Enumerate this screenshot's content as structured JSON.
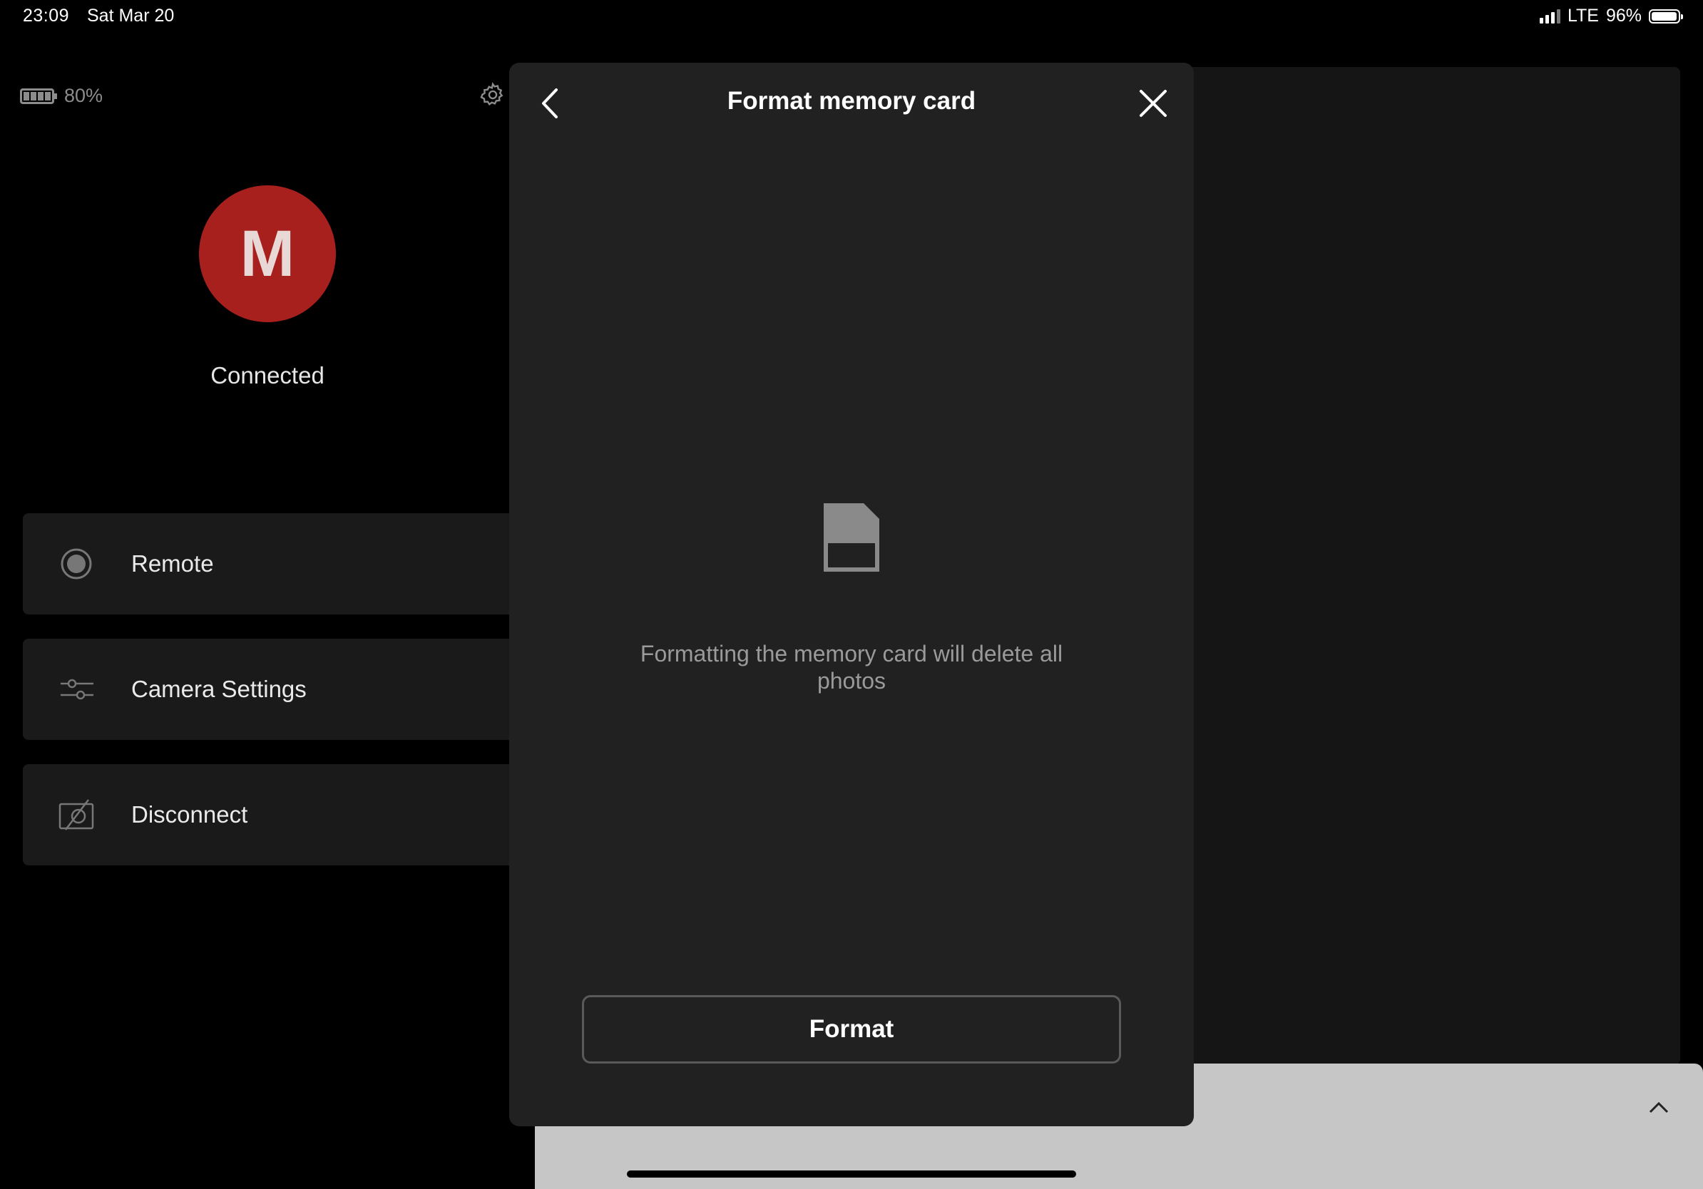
{
  "status_bar": {
    "time": "23:09",
    "date": "Sat Mar 20",
    "network": "LTE",
    "battery": "96%",
    "battery_fraction": 0.96
  },
  "left_panel": {
    "camera_battery": "80%",
    "avatar_letter": "M",
    "connection_status": "Connected",
    "menu": [
      {
        "label": "Remote",
        "icon": "record-icon"
      },
      {
        "label": "Camera Settings",
        "icon": "sliders-icon"
      },
      {
        "label": "Disconnect",
        "icon": "camera-off-icon"
      }
    ]
  },
  "modal": {
    "title": "Format memory card",
    "message": "Formatting the memory card will delete all photos",
    "button_label": "Format",
    "icon": "memory-card-icon"
  },
  "colors": {
    "avatar_bg": "#a8201d",
    "modal_bg": "#212121",
    "menu_bg": "#1a1a1a"
  }
}
